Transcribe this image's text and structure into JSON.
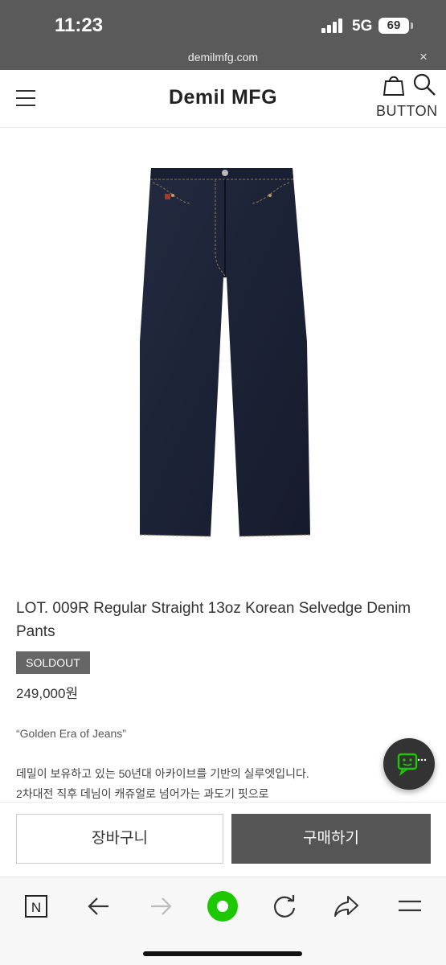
{
  "status_bar": {
    "time": "11:23",
    "network": "5G",
    "battery": "69"
  },
  "browser": {
    "url": "demilmfg.com",
    "close_glyph": "×"
  },
  "header": {
    "brand": "Demil MFG",
    "button_label": "BUTTON"
  },
  "product": {
    "title": "LOT. 009R Regular Straight 13oz Korean Selvedge Denim Pants",
    "badge": "SOLDOUT",
    "price": "249,000원",
    "quote": "“Golden Era of Jeans”",
    "desc_line1": "데밀이 보유하고 있는 50년대 아카이브를 기반의 실루엣입니다.",
    "desc_line2": "2차대전 직후 데님이 캐쥬얼로 넘어가는 과도기 핏으로",
    "image_icon": "denim-pants-image"
  },
  "actions": {
    "cart_label": "장바구니",
    "buy_label": "구매하기"
  },
  "toolbar": {
    "n_label": "N"
  },
  "colors": {
    "accent_green": "#1ec800",
    "status_bar": "#5a5a5a",
    "denim": "#1c2236",
    "buy_button": "#555555"
  }
}
